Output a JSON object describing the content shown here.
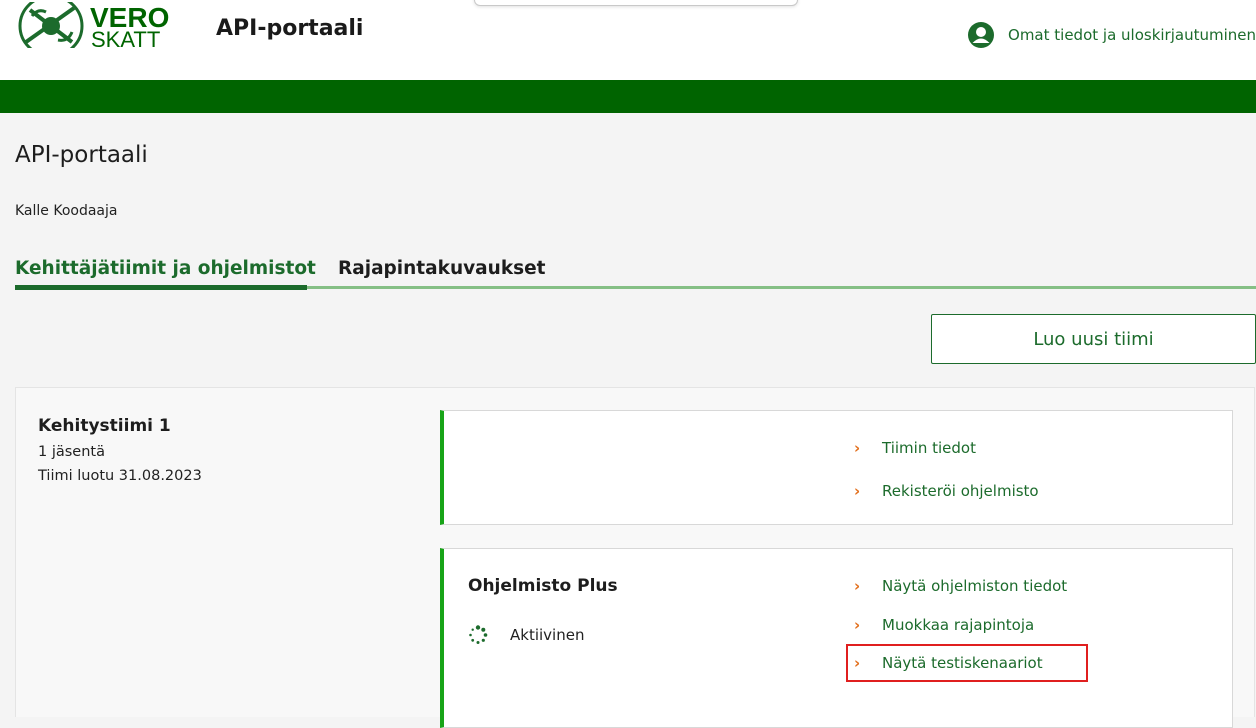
{
  "header": {
    "logo_line1": "VERO",
    "logo_line2": "SKATT",
    "site_title": "API-portaali",
    "account_link": "Omat tiedot ja uloskirjautuminen",
    "brand_color": "#006400",
    "link_color": "#1c6b2c"
  },
  "page": {
    "title": "API-portaali",
    "user_name": "Kalle Koodaaja"
  },
  "tabs": [
    {
      "label": "Kehittäjätiimit ja ohjelmistot",
      "active": true
    },
    {
      "label": "Rajapintakuvaukset",
      "active": false
    }
  ],
  "actions": {
    "new_team": "Luo uusi tiimi"
  },
  "team": {
    "name": "Kehitystiimi 1",
    "members": "1 jäsentä",
    "created": "Tiimi luotu 31.08.2023",
    "team_links": [
      "Tiimin tiedot",
      "Rekisteröi ohjelmisto"
    ],
    "software": {
      "name": "Ohjelmisto Plus",
      "status": "Aktiivinen",
      "status_icon": "spinner-icon",
      "links": [
        "Näytä ohjelmiston tiedot",
        "Muokkaa rajapintoja",
        "Näytä testiskenaariot"
      ],
      "highlighted_link": "Näytä testiskenaariot"
    }
  },
  "icons": {
    "account": "user-circle-icon",
    "chevron": "chevron-right-icon",
    "chevron_color": "#e26f1c"
  }
}
